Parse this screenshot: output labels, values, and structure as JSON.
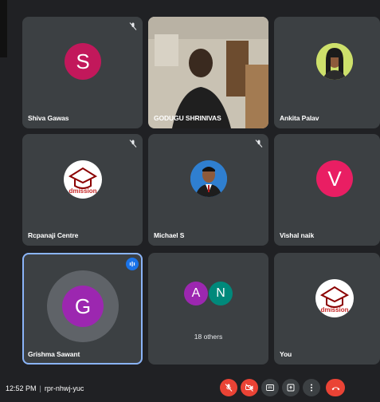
{
  "tiles": {
    "shiva": {
      "name": "Shiva Gawas",
      "initial": "S",
      "avatar_color": "#c2185b"
    },
    "godugu": {
      "name": "GODUGU SHRINIVAS"
    },
    "ankita": {
      "name": "Ankita Palav"
    },
    "rcpanaji": {
      "name": "Rcpanaji Centre",
      "logo_text": "dmission"
    },
    "michael": {
      "name": "Michael S"
    },
    "vishal": {
      "name": "Vishal naik",
      "initial": "V",
      "avatar_color": "#e91e63"
    },
    "grishma": {
      "name": "Grishma Sawant",
      "initial": "G",
      "avatar_color": "#9c27b0"
    },
    "others": {
      "initial_a": "A",
      "initial_n": "N",
      "label": "18 others",
      "color_a": "#9c27b0",
      "color_n": "#00897b"
    },
    "you": {
      "name": "You",
      "logo_text": "dmission"
    }
  },
  "bottom_bar": {
    "time": "12:52 PM",
    "meeting_code": "rpr-nhwj-yuc"
  },
  "colors": {
    "background": "#202124",
    "tile": "#3c4043",
    "active_border": "#8ab4f8",
    "danger": "#ea4335"
  },
  "icons": [
    "mic-off-icon",
    "camera-off-icon",
    "captions-icon",
    "present-icon",
    "more-options-icon",
    "leave-call-icon",
    "audio-level-icon"
  ]
}
